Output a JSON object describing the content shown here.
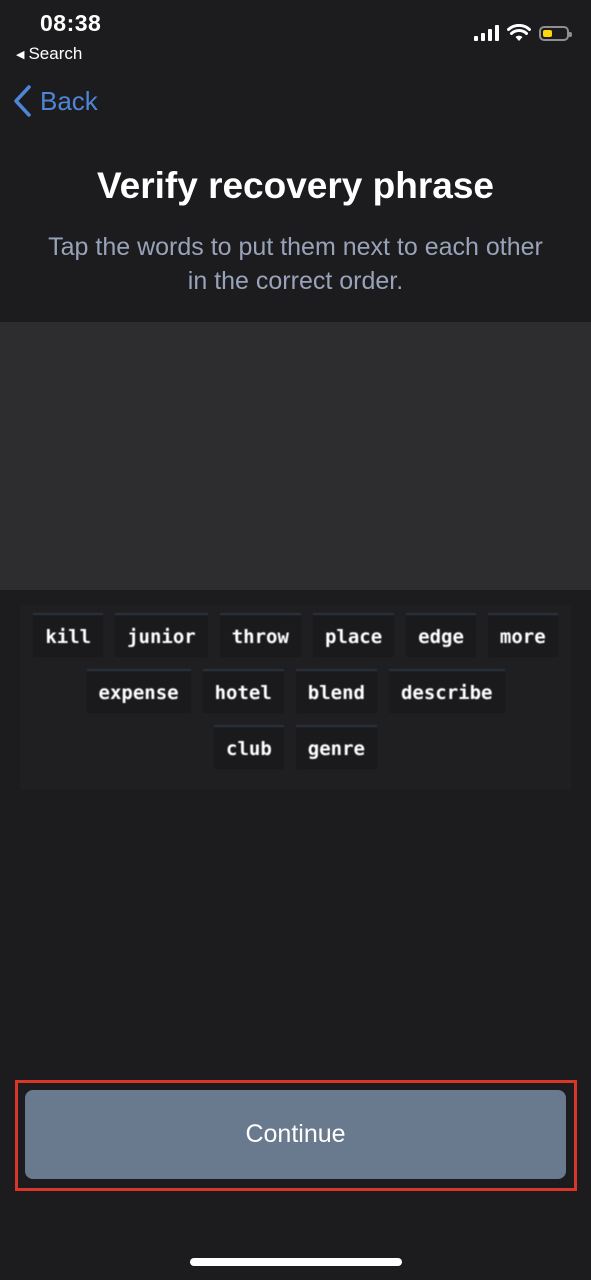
{
  "status_bar": {
    "time": "08:38",
    "back_app_label": "Search"
  },
  "nav": {
    "back_label": "Back"
  },
  "header": {
    "title": "Verify recovery phrase",
    "subtitle": "Tap the words to put them next to each other in the correct order."
  },
  "words": {
    "row1": [
      "kill",
      "junior",
      "throw",
      "place",
      "edge",
      "more"
    ],
    "row2": [
      "expense",
      "hotel",
      "blend",
      "describe"
    ],
    "row3": [
      "club",
      "genre"
    ]
  },
  "footer": {
    "continue_label": "Continue"
  },
  "colors": {
    "background": "#1c1c1e",
    "accent": "#4e86d6",
    "button": "#6a7a8e",
    "highlight_outline": "#d9362a"
  }
}
